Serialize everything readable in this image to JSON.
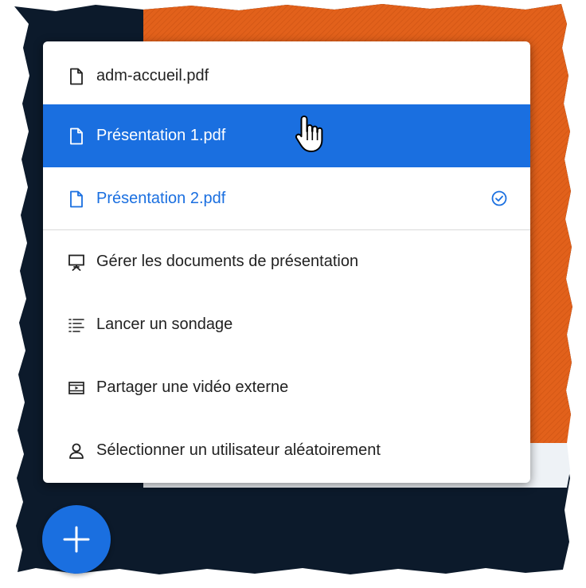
{
  "theme": {
    "accent": "#1a6fe0",
    "background_dark": "#0c1a2b",
    "presentation_orange": "#e2611b",
    "text": "#222222"
  },
  "menu": {
    "items": [
      {
        "label": "adm-accueil.pdf",
        "icon": "file-icon",
        "state": "normal"
      },
      {
        "label": "Présentation 1.pdf",
        "icon": "file-icon",
        "state": "hovered"
      },
      {
        "label": "Présentation 2.pdf",
        "icon": "file-icon",
        "state": "current",
        "badge_icon": "check-circle-icon"
      },
      {
        "label": "Gérer les documents de présentation",
        "icon": "presentation-screen-icon",
        "state": "normal"
      },
      {
        "label": "Lancer un sondage",
        "icon": "poll-list-icon",
        "state": "normal"
      },
      {
        "label": "Partager une vidéo externe",
        "icon": "video-frame-icon",
        "state": "normal"
      },
      {
        "label": "Sélectionner un utilisateur aléatoirement",
        "icon": "user-icon",
        "state": "normal"
      }
    ]
  },
  "fab": {
    "icon": "plus-icon"
  },
  "cursor": {
    "icon": "hand-pointer-icon"
  }
}
